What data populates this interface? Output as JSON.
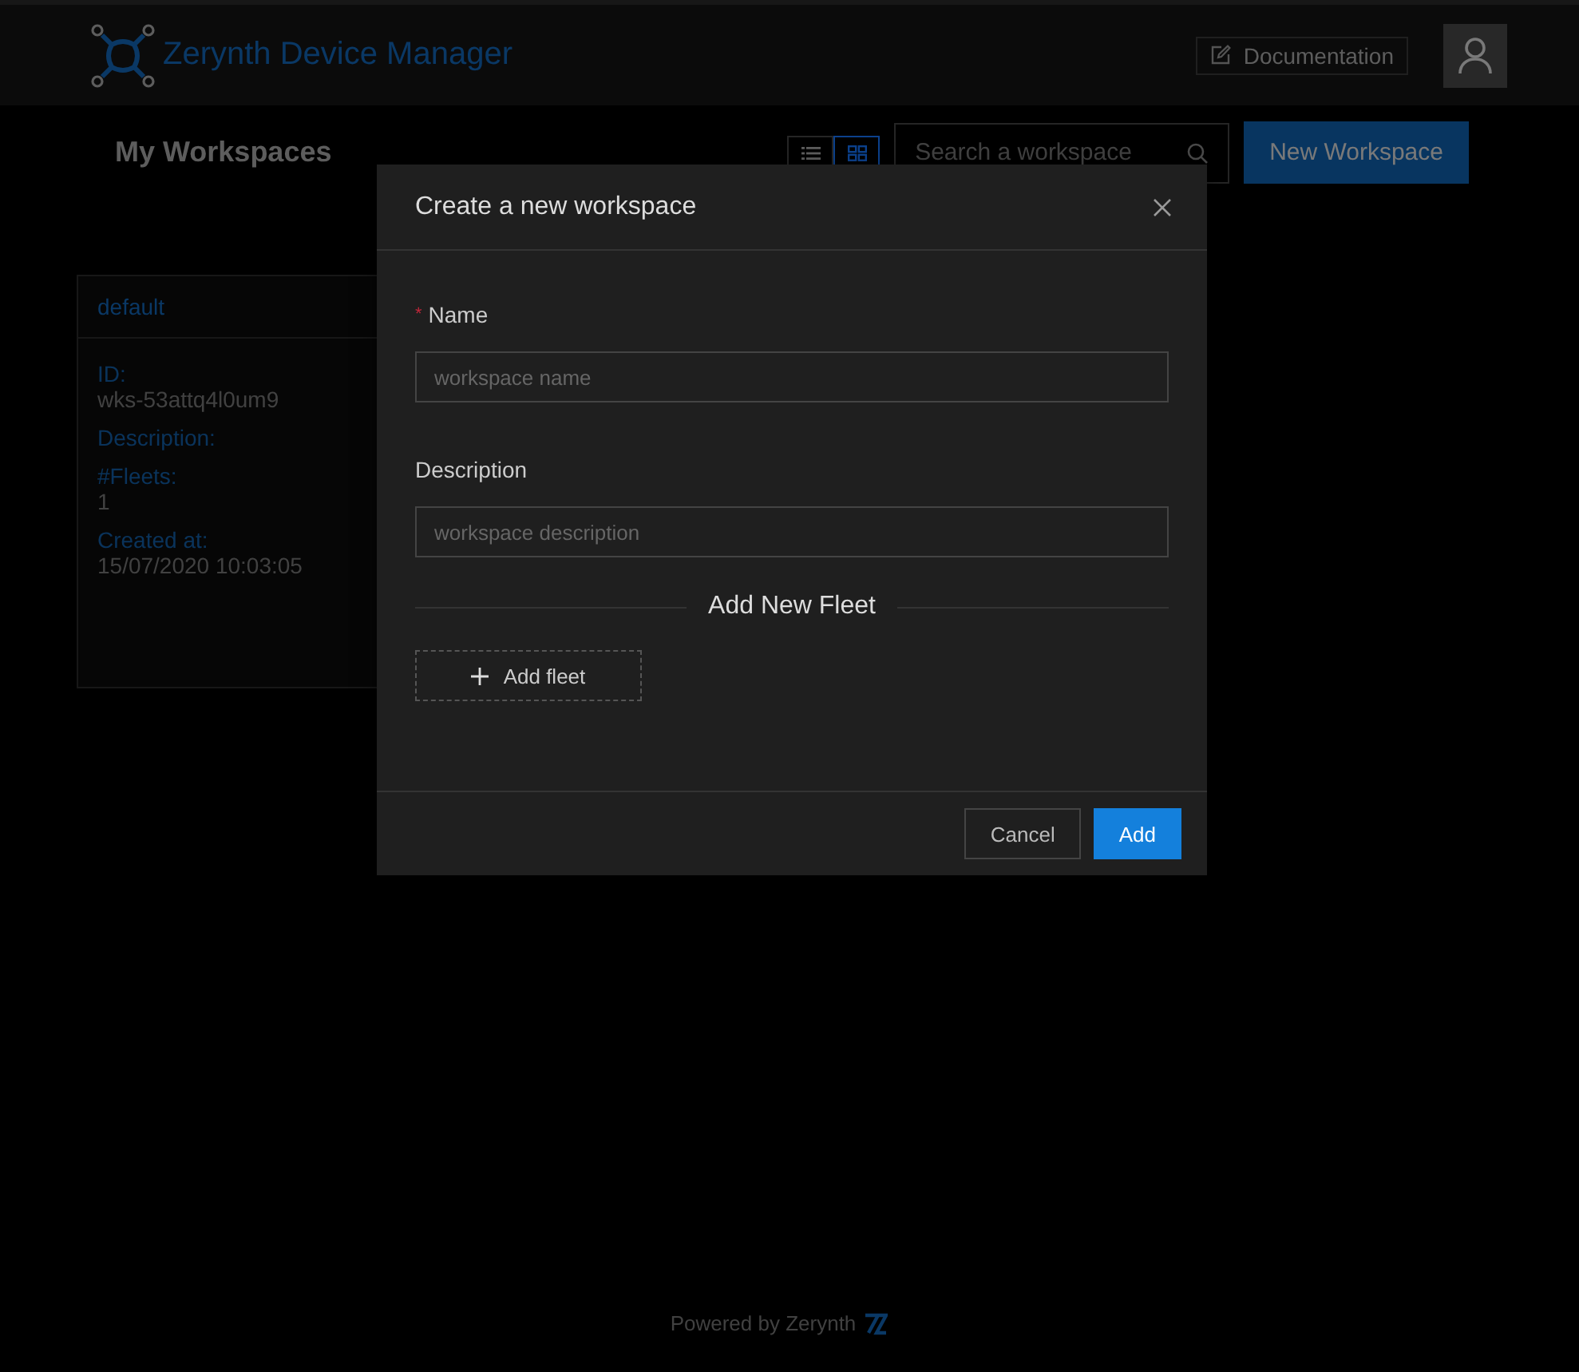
{
  "header": {
    "title": "Zerynth Device Manager",
    "docs_link": "Documentation"
  },
  "page": {
    "title": "My Workspaces",
    "view_toggle": [
      {
        "kind": "list",
        "selected": false
      },
      {
        "kind": "grid",
        "selected": true
      }
    ],
    "search": {
      "placeholder": "Search a workspace"
    },
    "new_button": "New Workspace"
  },
  "workspaces": [
    {
      "name": "default",
      "fields": [
        {
          "label": "ID:",
          "value": "wks-53attq4l0um9"
        },
        {
          "label": "Description:"
        },
        {
          "label": "#Fleets:",
          "value": "1"
        },
        {
          "label": "Created at:",
          "value": "15/07/2020 10:03:05"
        }
      ]
    }
  ],
  "dialog": {
    "title": "Create a new workspace",
    "fields": [
      {
        "label": "Name",
        "required_mark": "*",
        "placeholder": "workspace name"
      },
      {
        "label": "Description",
        "placeholder": "workspace description"
      }
    ],
    "section": "Add New Fleet",
    "add_fleet": "Add fleet",
    "buttons": [
      {
        "label": "Cancel",
        "kind": "default"
      },
      {
        "label": "Add",
        "kind": "primary"
      }
    ]
  },
  "footer": {
    "text": "Powered by Zerynth"
  }
}
